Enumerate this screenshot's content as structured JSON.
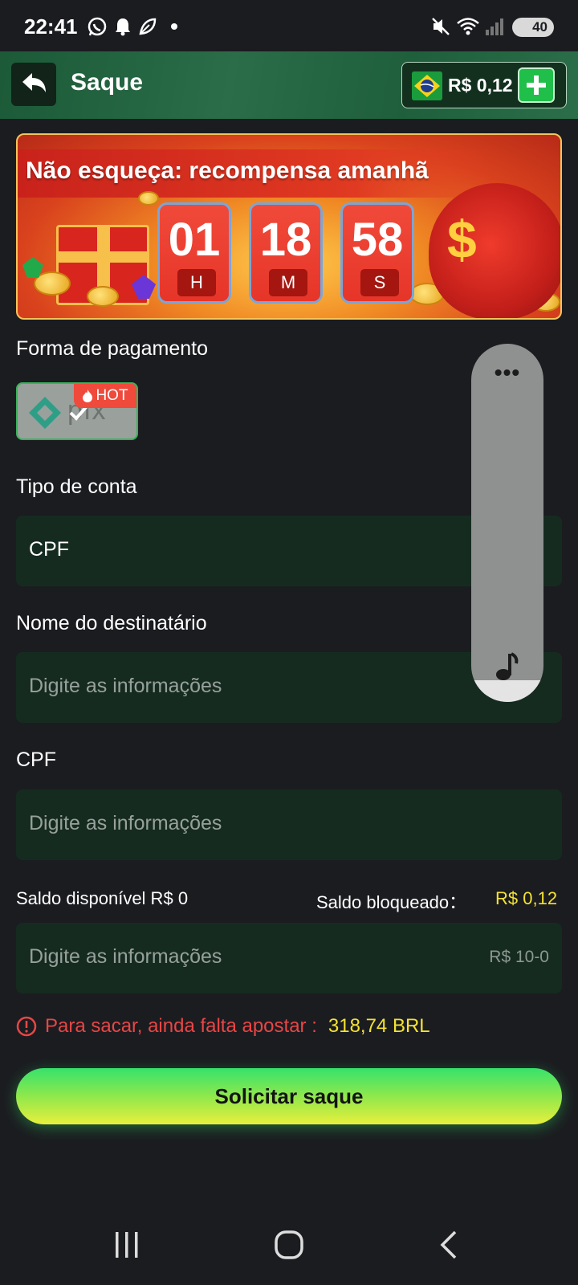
{
  "status_bar": {
    "time": "22:41",
    "battery": "40",
    "icons": [
      "whatsapp-icon",
      "bell-icon",
      "leaf-icon",
      "dot-icon",
      "mute-icon",
      "wifi-icon",
      "signal-icon",
      "battery-icon"
    ]
  },
  "header": {
    "title": "Saque",
    "balance": "R$ 0,12",
    "colors": {
      "bar": "#1f5f3c",
      "plus": "#1fbf4a"
    }
  },
  "banner": {
    "title": "Não esqueça: recompensa amanhã",
    "timer": [
      {
        "value": "01",
        "unit": "H"
      },
      {
        "value": "18",
        "unit": "M"
      },
      {
        "value": "58",
        "unit": "S"
      }
    ]
  },
  "payment": {
    "label": "Forma de pagamento",
    "method_badge": "HOT"
  },
  "account_type": {
    "label": "Tipo de conta",
    "value": "CPF"
  },
  "recipient": {
    "label": "Nome do destinatário",
    "placeholder": "Digite as informações"
  },
  "cpf": {
    "label": "CPF",
    "placeholder": "Digite as informações"
  },
  "amount": {
    "available_label": "Saldo disponível R$",
    "available_value": "0",
    "blocked_label": "Saldo bloqueado：",
    "blocked_value": "R$ 0,12",
    "placeholder": "Digite as informações",
    "range_hint": "R$ 10-0"
  },
  "warning": {
    "text": "Para sacar, ainda falta apostar :",
    "amount": "318,74 BRL"
  },
  "submit_label": "Solicitar saque",
  "volume_panel": {
    "menu": "•••",
    "level": 0.06
  }
}
